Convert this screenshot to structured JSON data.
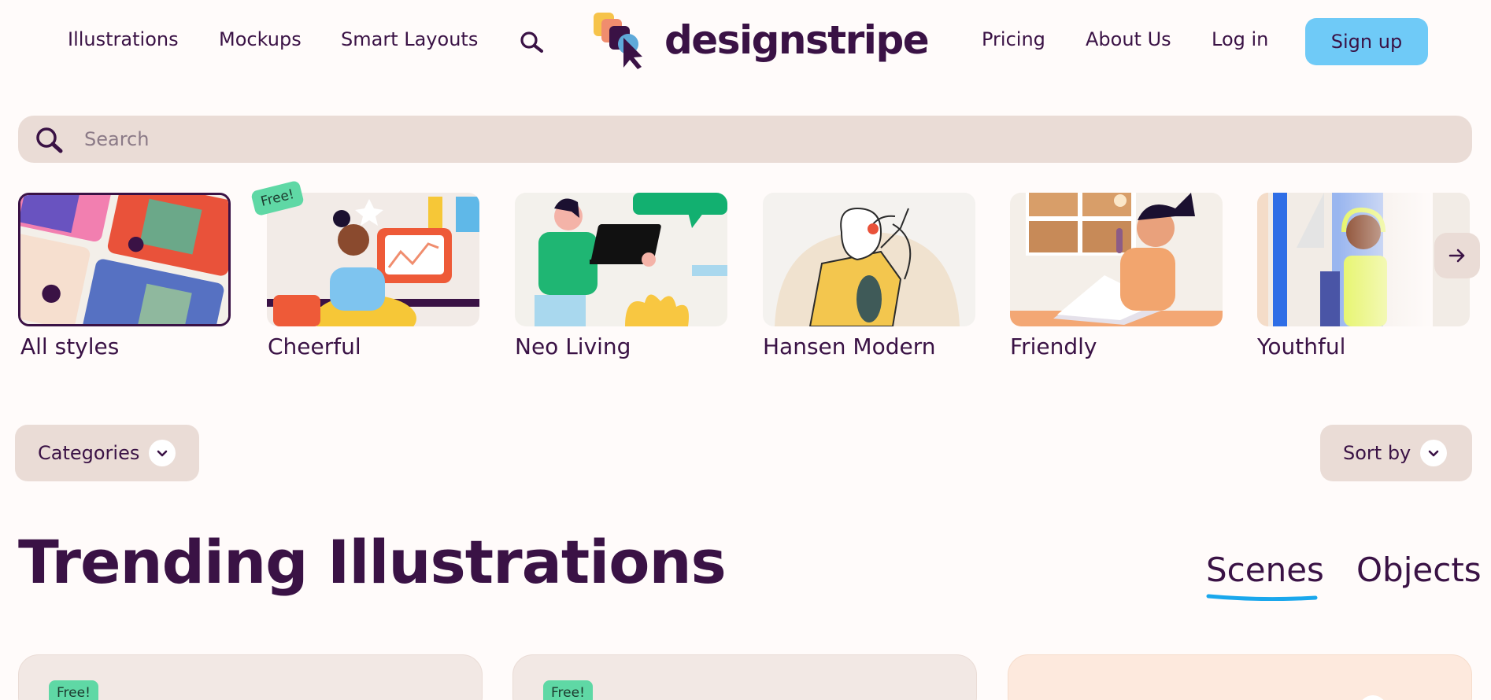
{
  "nav": {
    "left_links": [
      "Illustrations",
      "Mockups",
      "Smart Layouts"
    ],
    "brand": "designstripe",
    "right_links": [
      "Pricing",
      "About Us",
      "Log in"
    ],
    "signup_label": "Sign up"
  },
  "search": {
    "placeholder": "Search"
  },
  "styles": {
    "items": [
      {
        "label": "All styles",
        "selected": true
      },
      {
        "label": "Cheerful",
        "badge": "Free!"
      },
      {
        "label": "Neo Living"
      },
      {
        "label": "Hansen Modern"
      },
      {
        "label": "Friendly"
      },
      {
        "label": "Youthful"
      }
    ]
  },
  "filters": {
    "categories_label": "Categories",
    "sort_label": "Sort by"
  },
  "section": {
    "title": "Trending Illustrations",
    "tabs": [
      {
        "label": "Scenes",
        "active": true
      },
      {
        "label": "Objects",
        "active": false
      }
    ]
  },
  "cards": [
    {
      "badge": "Free!"
    },
    {
      "badge": "Free!"
    },
    {}
  ],
  "colors": {
    "primary_text": "#3a1245",
    "signup_bg": "#6fcaf7",
    "free_badge": "#5fd8a5",
    "surface": "#eadcd6",
    "underline": "#1aa7ec"
  }
}
